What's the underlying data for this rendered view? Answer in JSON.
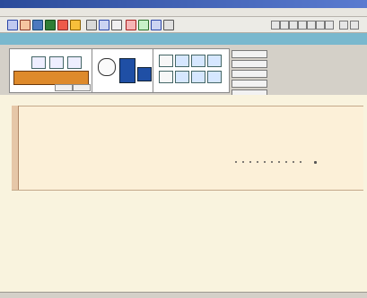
{
  "window": {
    "title": ""
  },
  "menu": {
    "items": []
  },
  "header": {
    "line1": "",
    "line2": ""
  },
  "actions": {
    "labels": []
  },
  "chart_area": {
    "dot_count": 11
  },
  "status": {
    "left": "",
    "middle": "",
    "right": ""
  },
  "colors": {
    "header_bg": "#79b8ce",
    "panel_bg": "#ffffff",
    "content_bg": "#fcf0d8",
    "title_blue": "#2a4b9a"
  }
}
